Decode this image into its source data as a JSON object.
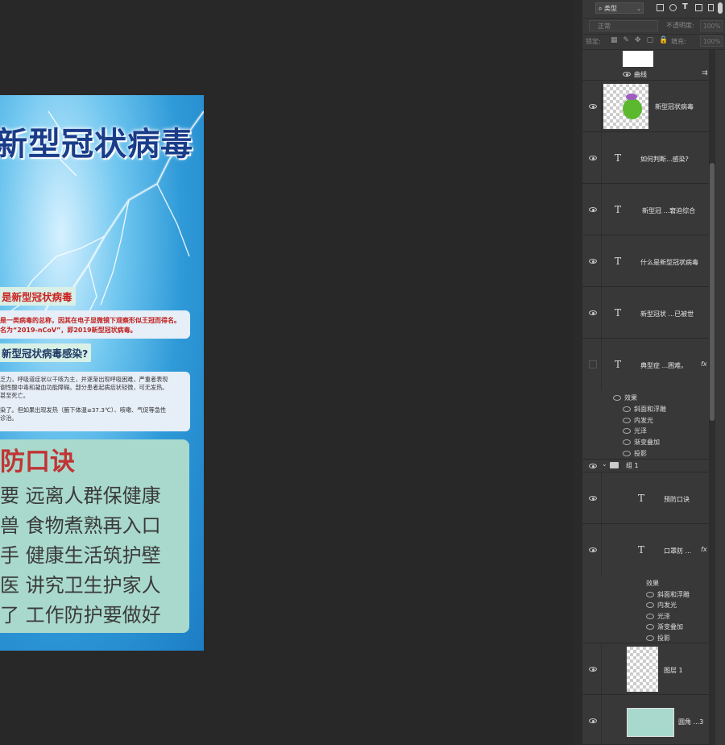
{
  "document": {
    "title": "新型冠状病毒",
    "section1": {
      "heading": "是新型冠状病毒",
      "lines": [
        "是一类病毒的总称，因其在电子显微镜下观察形似王冠而得名。",
        "名为“2019-nCoV”，即2019新型冠状病毒。"
      ]
    },
    "section2": {
      "heading": "新型冠状病毒感染?",
      "lines": [
        "乏力，呼吸道症状以干咳为主，并逐渐出现呼吸困难，严重者表现",
        "谢性酸中毒和凝血功能障碍。部分患者起病症状轻微，可无发热。",
        "甚至死亡。",
        "",
        "染了。但如果出现发热（腋下体温≥37.3℃）、咳嗽、气促等急性",
        "诊治。"
      ]
    },
    "rhyme": {
      "title": "防口诀",
      "lines": [
        "要  远离人群保健康",
        "兽  食物煮熟再入口",
        "手  健康生活筑护壁",
        "医  讲究卫生护家人",
        "了  工作防护要做好"
      ]
    }
  },
  "panel": {
    "filter_label": "类型",
    "blend_mode": "正常",
    "opacity_label": "不透明度:",
    "opacity_value": "100%",
    "lock_label": "锁定:",
    "fill_label": "填充:",
    "fill_value": "100%",
    "layers": {
      "curves": "曲线",
      "virus": "新型冠状病毒",
      "t1": "如何判断...感染?",
      "t2": "新型冠 ...窘迫综合",
      "t3": "什么是新型冠状病毒",
      "t4": "新型冠状 ...已被世",
      "t5": "典型症 ...困难。",
      "fx_label": "fx",
      "effects_label": "效果",
      "effects": [
        "斜面和浮雕",
        "内发光",
        "光泽",
        "渐变叠加",
        "投影"
      ],
      "group": "组 1",
      "t6": "预防口诀",
      "t7": "口罩防 ...",
      "effects2": [
        "斜面和浮雕",
        "内发光",
        "光泽",
        "渐变叠加",
        "投影"
      ],
      "layer1": "图层 1",
      "rounded": "圆角 ...3"
    }
  }
}
